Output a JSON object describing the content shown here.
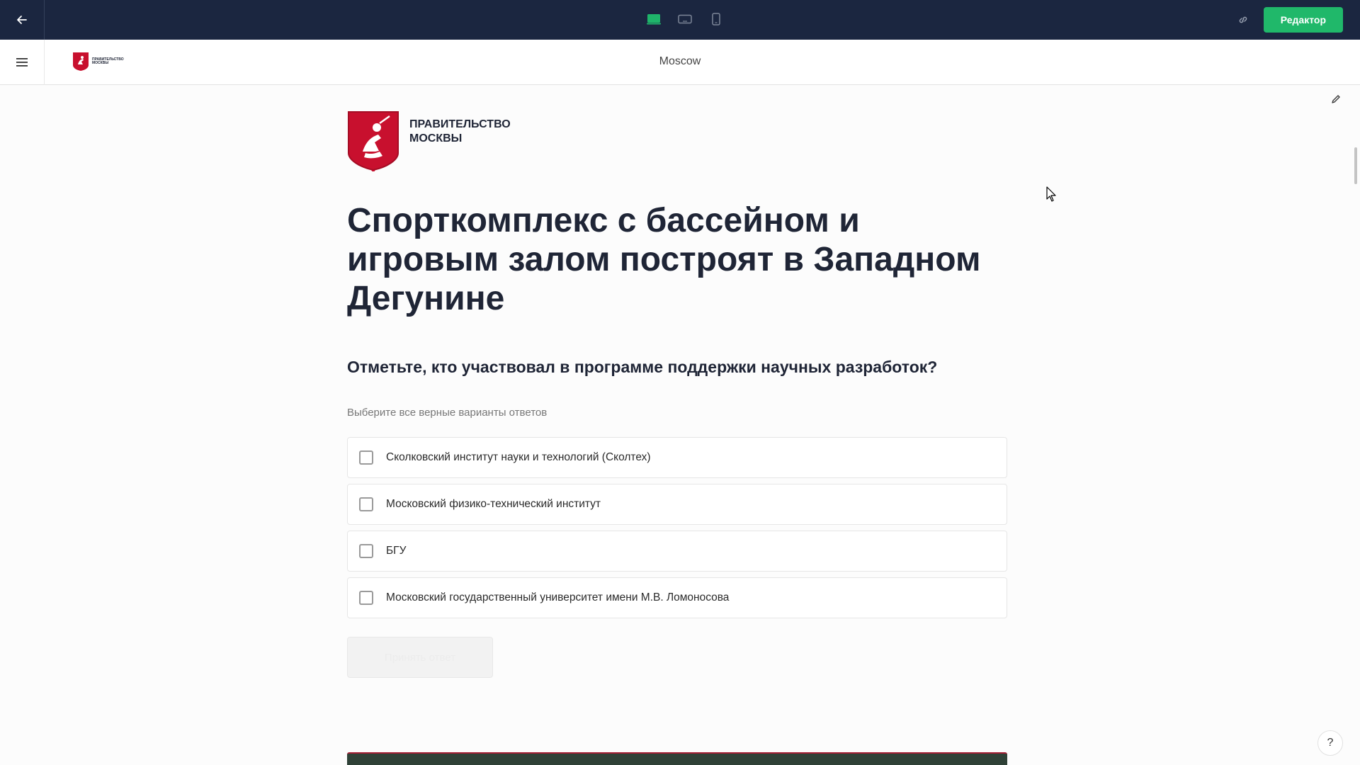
{
  "toolbar": {
    "back_icon": "arrow-left-icon",
    "devices": [
      {
        "name": "desktop",
        "icon": "monitor-icon",
        "active": true
      },
      {
        "name": "tablet",
        "icon": "tablet-landscape-icon",
        "active": false
      },
      {
        "name": "mobile",
        "icon": "phone-icon",
        "active": false
      }
    ],
    "link_icon": "link-icon",
    "editor_label": "Редактор",
    "accent_color": "#20b86a",
    "bg_color": "#1b2640"
  },
  "header": {
    "menu_icon": "hamburger-icon",
    "city": "Moscow",
    "logo_text": "ПРАВИТЕЛЬСТВО МОСКВЫ"
  },
  "article": {
    "org_line1": "ПРАВИТЕЛЬСТВО",
    "org_line2": "МОСКВЫ",
    "title": "Спорткомплекс с бассейном и игровым залом построят в Западном Дегунине",
    "quiz": {
      "question": "Отметьте, кто участвовал в программе поддержки научных разработок?",
      "hint": "Выберите все верные варианты ответов",
      "options": [
        {
          "label": "Сколковский институт науки и технологий (Сколтех)",
          "checked": false
        },
        {
          "label": "Московский физико-технический институт",
          "checked": false
        },
        {
          "label": "БГУ",
          "checked": false
        },
        {
          "label": "Московский государственный университет имени М.В. Ломоносова",
          "checked": false
        }
      ],
      "submit_label": "Принять ответ"
    }
  },
  "help_label": "?"
}
